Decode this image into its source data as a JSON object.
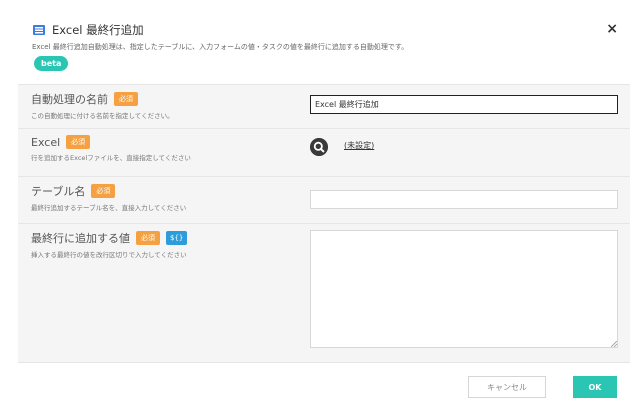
{
  "dialog": {
    "title": "Excel 最終行追加",
    "description": "Excel 最終行追加自動処理は、指定したテーブルに、入力フォームの値・タスクの値を最終行に追加する自動処理です。",
    "badge": "beta",
    "close_symbol": "×"
  },
  "fields": {
    "name": {
      "label": "自動処理の名前",
      "required": "必須",
      "help": "この自動処理に付ける名前を指定してください。",
      "value": "Excel 最終行追加"
    },
    "excel": {
      "label": "Excel",
      "required": "必須",
      "help": "行を追加するExcelファイルを、直接指定してください",
      "link": "(未設定)"
    },
    "table": {
      "label": "テーブル名",
      "required": "必須",
      "help": "最終行追加するテーブル名を、直接入力してください",
      "value": ""
    },
    "values": {
      "label": "最終行に追加する値",
      "required": "必須",
      "var_badge": "${}",
      "help": "挿入する最終行の値を改行区切りで入力してください",
      "value": ""
    }
  },
  "footer": {
    "cancel": "キャンセル",
    "ok": "OK"
  },
  "colors": {
    "accent": "#2bc6b3",
    "required": "#f5a142",
    "variable": "#2d9cdb"
  },
  "icons": {
    "title": "excel-sheet-icon",
    "excel_picker": "search-icon",
    "close": "close-icon"
  }
}
